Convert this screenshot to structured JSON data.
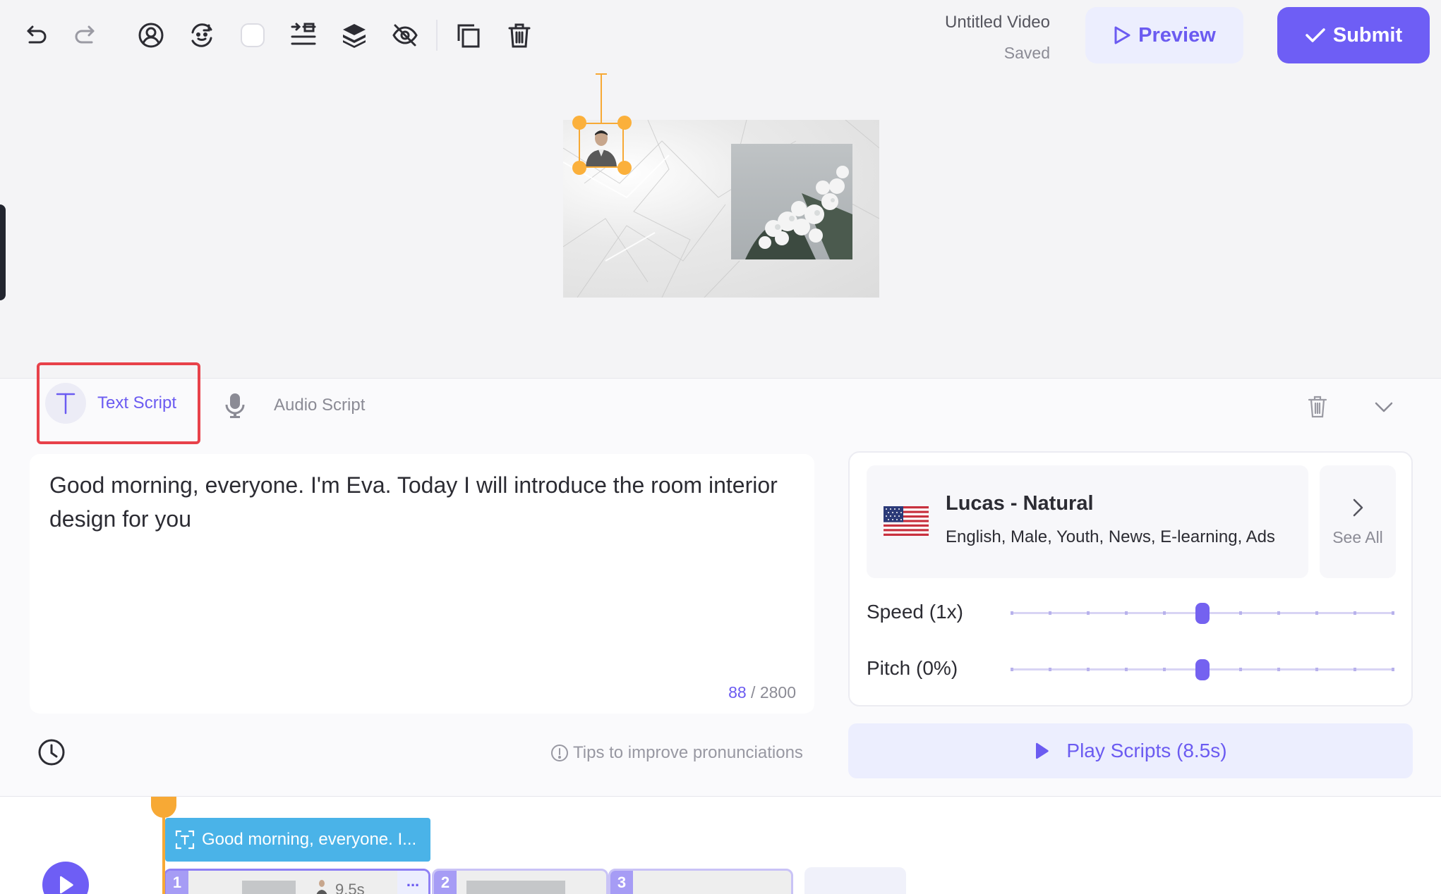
{
  "toolbar": {
    "icons": [
      "undo-icon",
      "redo-icon",
      "avatar-icon",
      "face-swap-icon",
      "background-color-icon",
      "align-icon",
      "layers-icon",
      "hide-icon",
      "duplicate-icon",
      "trash-icon"
    ],
    "doc_title": "Untitled Video",
    "doc_status": "Saved",
    "preview_label": "Preview",
    "submit_label": "Submit"
  },
  "script_tabs": {
    "text_label": "Text Script",
    "audio_label": "Audio Script"
  },
  "editor": {
    "text": "Good morning, everyone. I'm Eva. Today I will introduce the room interior design for you",
    "count": "88",
    "max": " / 2800",
    "tips": "Tips to improve pronunciations"
  },
  "voice": {
    "name": "Lucas - Natural",
    "description": "English, Male, Youth, News, E-learning, Ads",
    "see_all": "See All",
    "speed_label": "Speed (1x)",
    "speed_value": 0.5,
    "pitch_label": "Pitch (0%)",
    "pitch_value": 0.5,
    "play_label": "Play Scripts (8.5s)"
  },
  "timeline": {
    "script_clip": "Good morning, everyone. I...",
    "scenes": [
      {
        "num": "1",
        "duration": "9.5s",
        "more": "..."
      },
      {
        "num": "2"
      },
      {
        "num": "3"
      }
    ]
  },
  "colors": {
    "accent": "#6e5ef5",
    "selection": "#f7a935",
    "highlight_box": "#e8414a",
    "clip": "#4ab3e8"
  }
}
